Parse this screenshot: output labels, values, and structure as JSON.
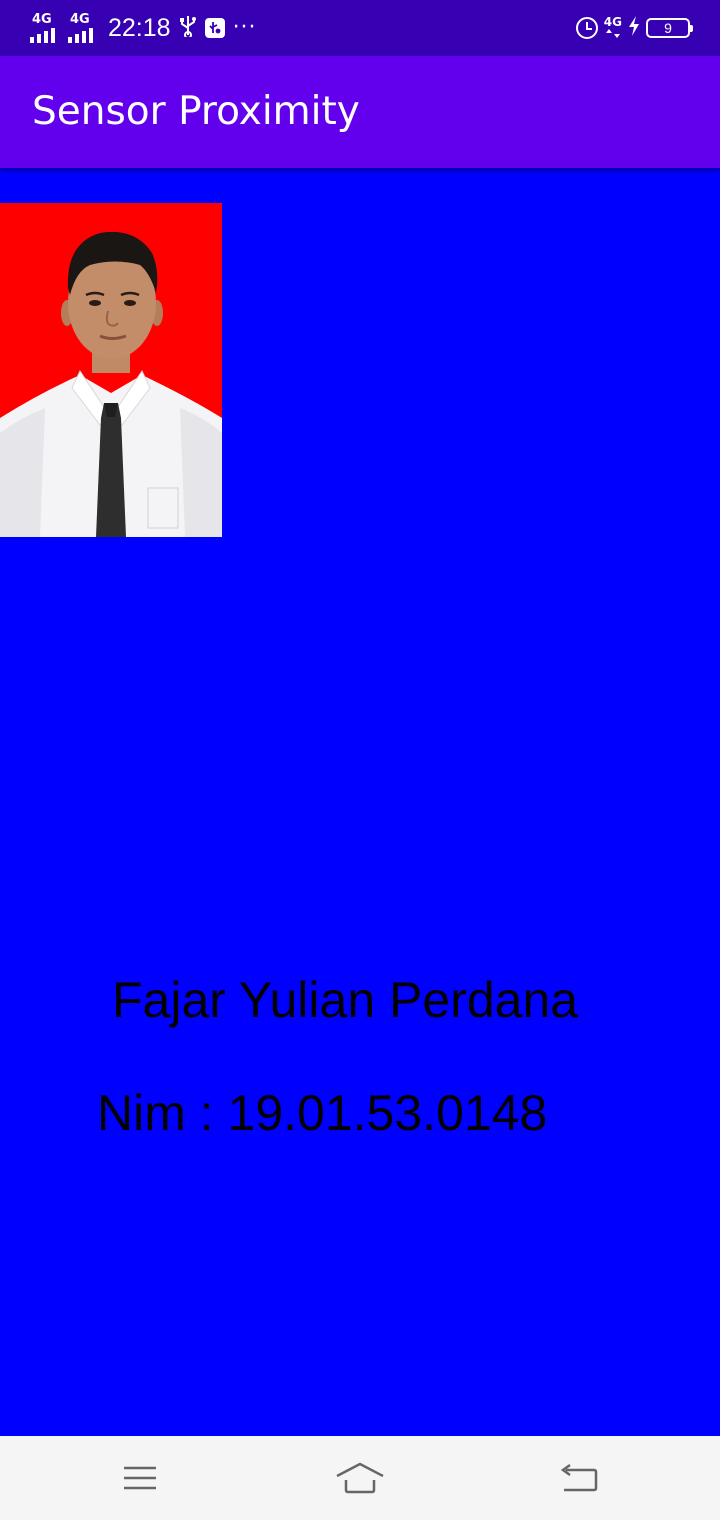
{
  "status_bar": {
    "signal1_label": "4G",
    "signal2_label": "4G",
    "time": "22:18",
    "usb_icon": "usb-icon",
    "usb_debug_icon": "usb-debug-icon",
    "more": "···",
    "alarm_icon": "alarm-icon",
    "network_type": "4G",
    "charging_icon": "bolt-icon",
    "battery_level": "9"
  },
  "app_bar": {
    "title": "Sensor Proximity",
    "color": "#6200ee"
  },
  "content": {
    "background_color": "#0000ff",
    "photo_background": "#ff0000",
    "name": "Fajar Yulian Perdana",
    "nim": "Nim : 19.01.53.0148"
  },
  "nav_bar": {
    "menu_icon": "menu-icon",
    "home_icon": "home-icon",
    "back_icon": "back-icon"
  }
}
